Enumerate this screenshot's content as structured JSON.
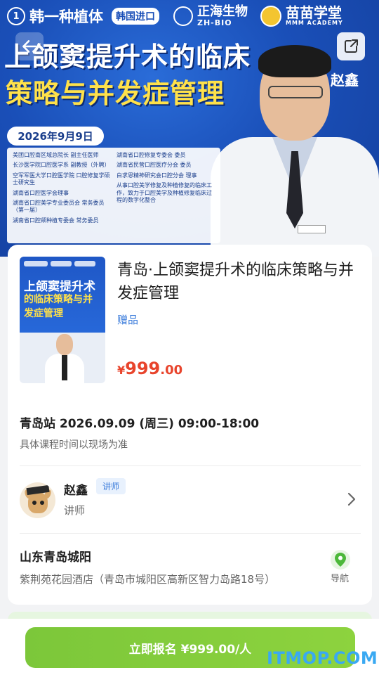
{
  "banner": {
    "logo_hanyi": "韩一种植体",
    "logo_hanyi_tag": "韩国进口",
    "logo_zh_cn": "正海生物",
    "logo_zh_en": "ZH-BIO",
    "logo_mmm_cn": "苗苗学堂",
    "logo_mmm_en": "MMM ACADEMY",
    "title_line1": "上颌窦提升术的临床",
    "title_line2": "策略与并发症管理",
    "speaker": "赵鑫",
    "date": "2026年9月9日",
    "bio_left": [
      "美团口腔南区域总院长 副主任医师",
      "长沙医学院口腔医学系 副教授（外聘）",
      "空军军医大学口腔医学院 口腔修复学硕士研究生",
      "湖南省口腔医学会理事",
      "湖南省口腔美学专业委员会 常务委员（第一届）",
      "湖南省口腔颌种植专委会 常务委员"
    ],
    "bio_right": [
      "湖南省口腔修复专委会 委员",
      "湖南省民营口腔医疗分会 委员",
      "白求恩精神研究会口腔分会 理事",
      "从事口腔美学修复及种植修复的临床工作，致力于口腔美学及种植修复临床过程的数字化整合"
    ]
  },
  "course": {
    "title": "青岛·上颌窦提升术的临床策略与并发症管理",
    "tag": "赠品",
    "price_symbol": "¥",
    "price_int": "999",
    "price_dec": ".00",
    "cover_line1": "上颌窦提升术",
    "cover_line2": "的临床策略与并",
    "cover_line3": "发症管理"
  },
  "session": {
    "title": "青岛站 2026.09.09 (周三) 09:00-18:00",
    "note": "具体课程时间以现场为准"
  },
  "teacher": {
    "name": "赵鑫",
    "badge": "讲师",
    "role": "讲师"
  },
  "location": {
    "city": "山东青岛城阳",
    "address": "紫荆苑花园酒店（青岛市城阳区高新区智力岛路18号）",
    "nav_label": "导航"
  },
  "footer": {
    "signup_label": "立即报名 ¥999.00/人",
    "watermark": "ITMOP.COM"
  },
  "colors": {
    "accent_green": "#8dd33e",
    "price_red": "#e8442c",
    "link_blue": "#3a7bdb",
    "banner_blue": "#1a4fb8"
  }
}
